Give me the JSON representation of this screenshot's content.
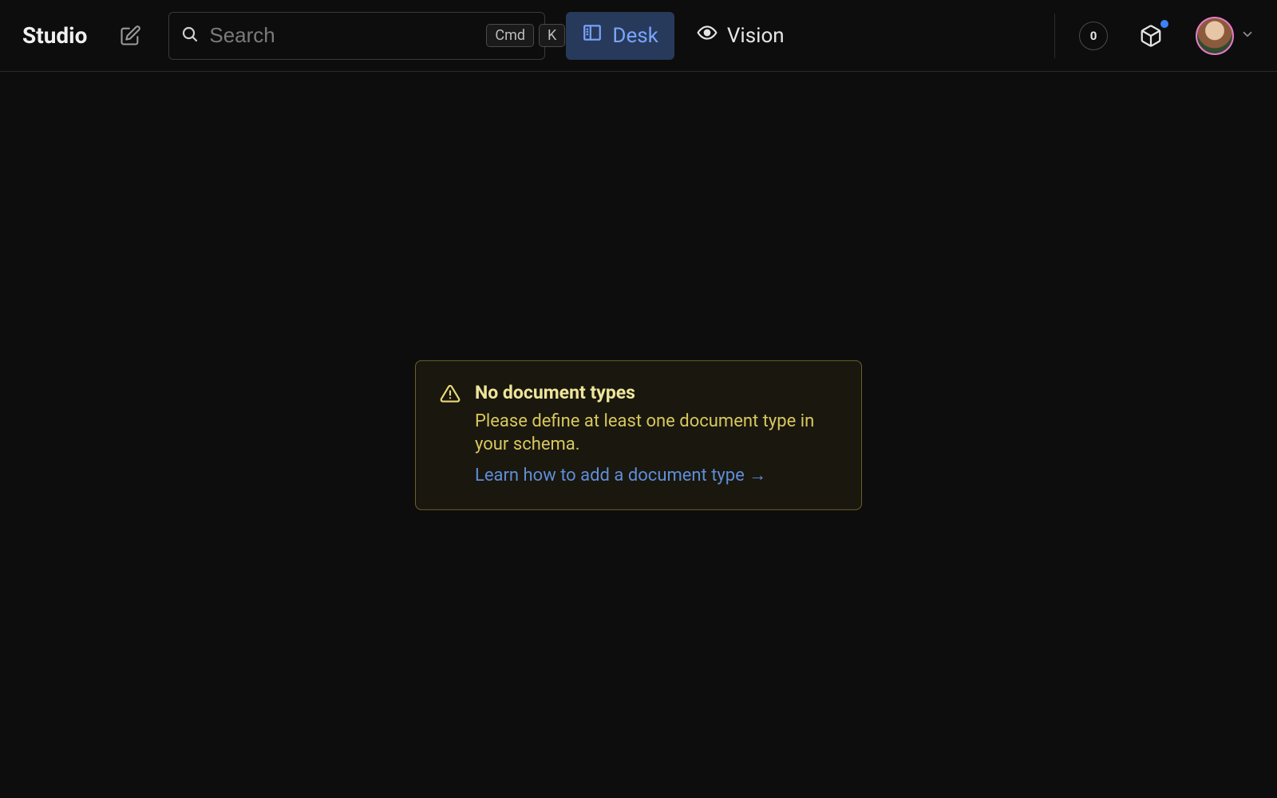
{
  "header": {
    "appTitle": "Studio",
    "search": {
      "placeholder": "Search",
      "kbdMod": "Cmd",
      "kbdKey": "K"
    },
    "tabs": [
      {
        "label": "Desk",
        "active": true
      },
      {
        "label": "Vision",
        "active": false
      }
    ],
    "notificationCount": "0"
  },
  "warning": {
    "title": "No document types",
    "description": "Please define at least one document type in your schema.",
    "linkText": "Learn how to add a document type →"
  }
}
